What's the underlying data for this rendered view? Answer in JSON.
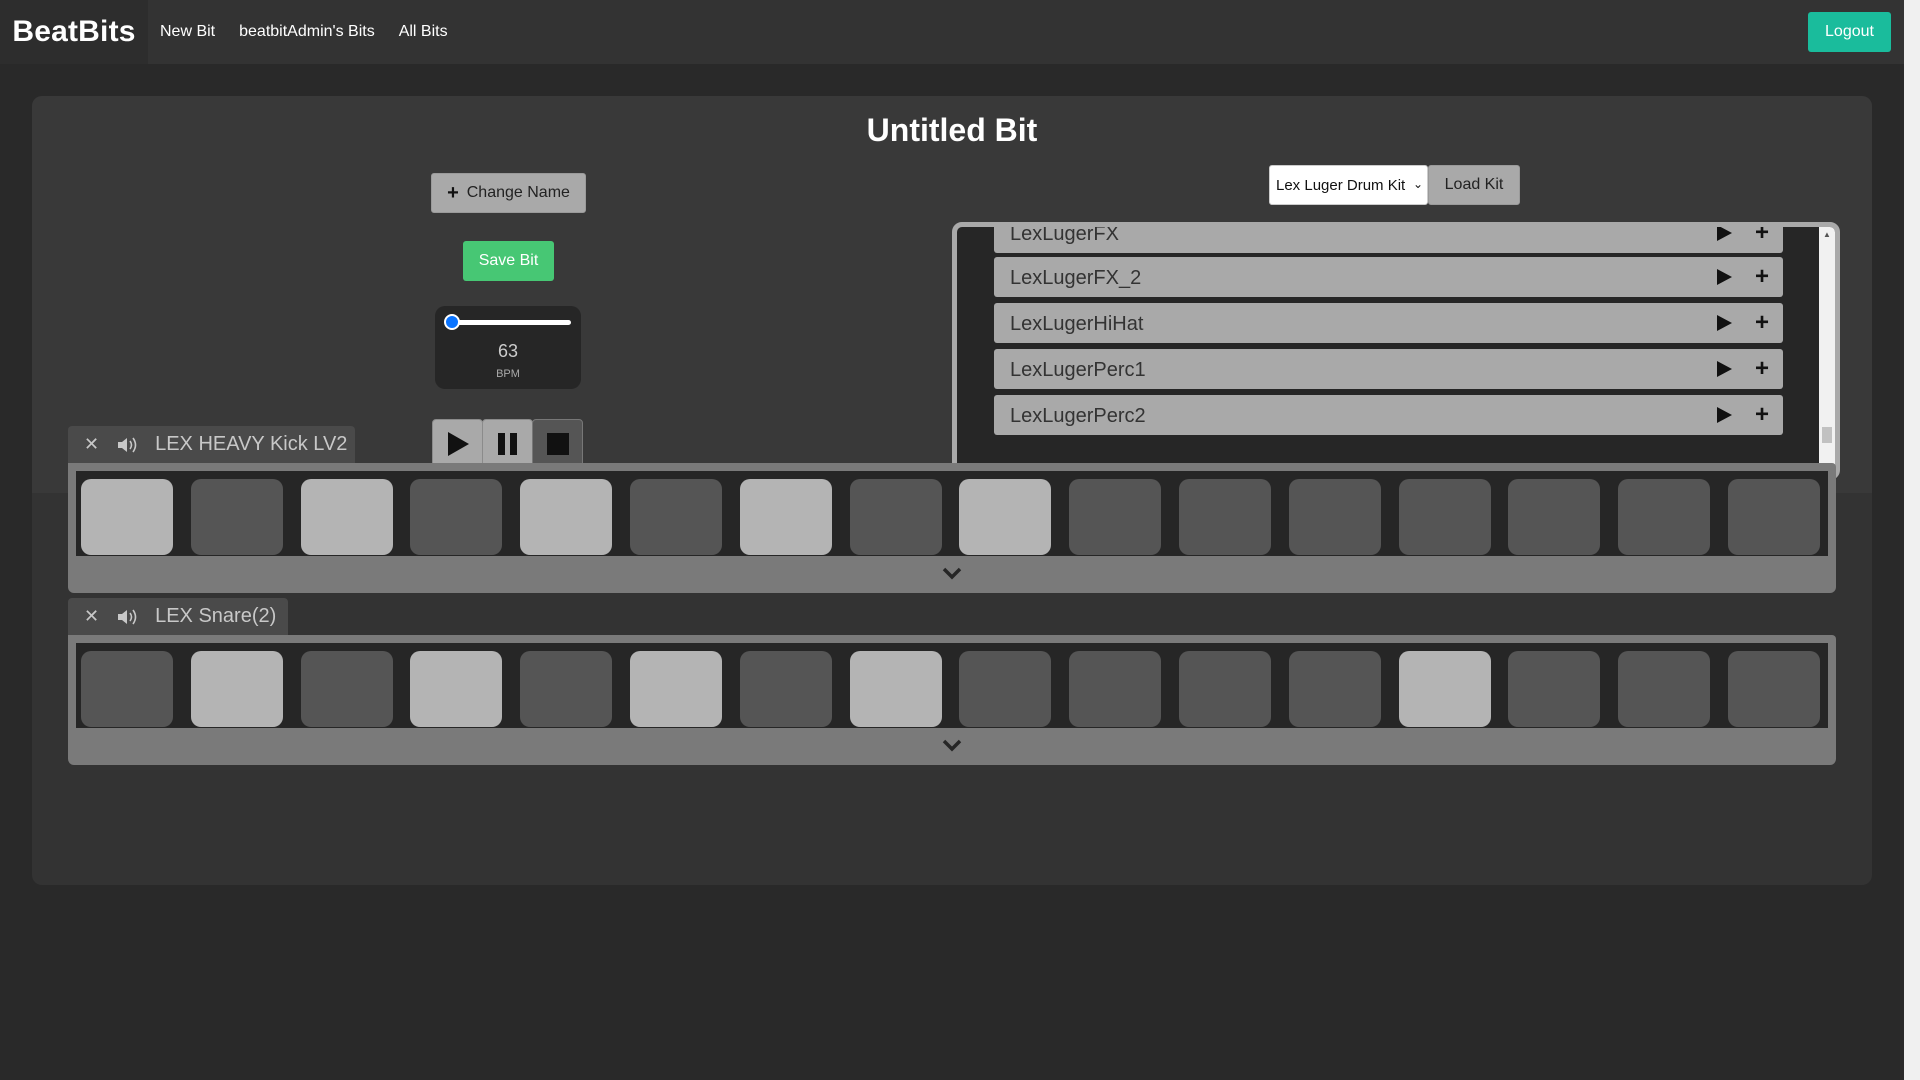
{
  "navbar": {
    "brand": "BeatBits",
    "links": [
      "New Bit",
      "beatbitAdmin's Bits",
      "All Bits"
    ],
    "logout_label": "Logout"
  },
  "bit": {
    "title": "Untitled Bit",
    "change_name_label": "Change Name",
    "save_label": "Save Bit"
  },
  "tempo": {
    "value": "63",
    "unit": "BPM",
    "slider_fraction": 0.04
  },
  "kit": {
    "selected": "Lex Luger Drum Kit",
    "load_label": "Load Kit",
    "samples": [
      "LexLugerFX",
      "LexLugerFX_2",
      "LexLugerHiHat",
      "LexLugerPerc1",
      "LexLugerPerc2"
    ]
  },
  "tracks": [
    {
      "name": "LEX HEAVY Kick LV2",
      "steps": [
        1,
        0,
        1,
        0,
        1,
        0,
        1,
        0,
        1,
        0,
        0,
        0,
        0,
        0,
        0,
        0
      ]
    },
    {
      "name": "LEX Snare(2)",
      "steps": [
        0,
        1,
        0,
        1,
        0,
        1,
        0,
        1,
        0,
        0,
        0,
        0,
        1,
        0,
        0,
        0
      ]
    }
  ],
  "colors": {
    "accent_teal": "#1abc9c",
    "save_green": "#47c774",
    "slider_blue": "#0a74ff",
    "pad_on": "#b4b4b4",
    "pad_off": "#555555"
  },
  "icons": {
    "transport": [
      "play-icon",
      "pause-icon",
      "stop-icon"
    ],
    "sample_row": [
      "play-icon",
      "plus-icon"
    ],
    "track_tab": [
      "close-icon",
      "volume-icon"
    ],
    "track_footer": "chevron-down-icon"
  }
}
